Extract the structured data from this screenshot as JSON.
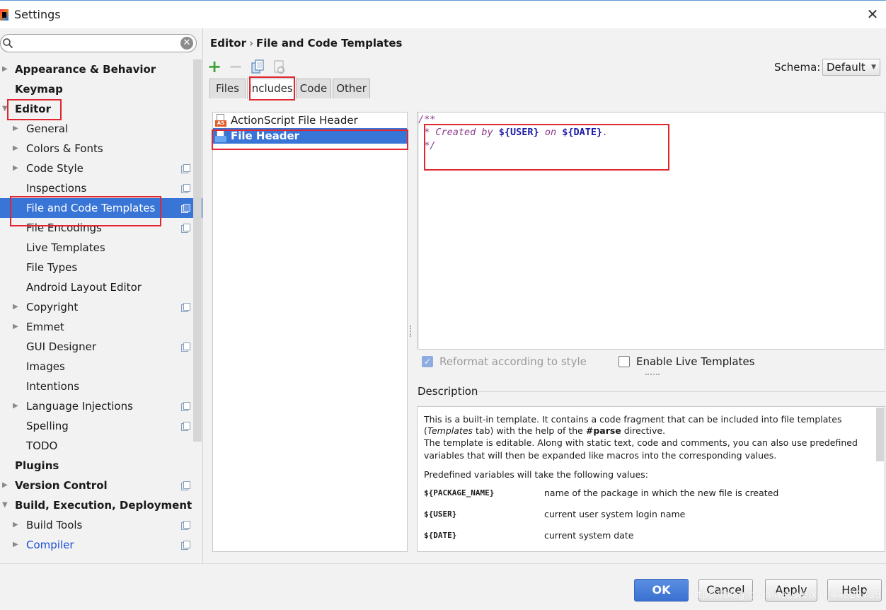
{
  "window": {
    "title": "Settings"
  },
  "search": {
    "value": "",
    "placeholder": ""
  },
  "sidebar": {
    "items": [
      {
        "label": "Appearance & Behavior",
        "level": 0,
        "arrow": "right"
      },
      {
        "label": "Keymap",
        "level": 0,
        "arrow": ""
      },
      {
        "label": "Editor",
        "level": 0,
        "arrow": "down"
      },
      {
        "label": "General",
        "level": 1,
        "arrow": "right"
      },
      {
        "label": "Colors & Fonts",
        "level": 1,
        "arrow": "right"
      },
      {
        "label": "Code Style",
        "level": 1,
        "arrow": "right",
        "project": true
      },
      {
        "label": "Inspections",
        "level": 1,
        "arrow": "",
        "project": true
      },
      {
        "label": "File and Code Templates",
        "level": 1,
        "arrow": "",
        "project": true,
        "selected": true
      },
      {
        "label": "File Encodings",
        "level": 1,
        "arrow": "",
        "project": true
      },
      {
        "label": "Live Templates",
        "level": 1,
        "arrow": ""
      },
      {
        "label": "File Types",
        "level": 1,
        "arrow": ""
      },
      {
        "label": "Android Layout Editor",
        "level": 1,
        "arrow": ""
      },
      {
        "label": "Copyright",
        "level": 1,
        "arrow": "right",
        "project": true
      },
      {
        "label": "Emmet",
        "level": 1,
        "arrow": "right"
      },
      {
        "label": "GUI Designer",
        "level": 1,
        "arrow": "",
        "project": true
      },
      {
        "label": "Images",
        "level": 1,
        "arrow": ""
      },
      {
        "label": "Intentions",
        "level": 1,
        "arrow": ""
      },
      {
        "label": "Language Injections",
        "level": 1,
        "arrow": "right",
        "project": true
      },
      {
        "label": "Spelling",
        "level": 1,
        "arrow": "",
        "project": true
      },
      {
        "label": "TODO",
        "level": 1,
        "arrow": ""
      },
      {
        "label": "Plugins",
        "level": 0,
        "arrow": ""
      },
      {
        "label": "Version Control",
        "level": 0,
        "arrow": "right",
        "project": true
      },
      {
        "label": "Build, Execution, Deployment",
        "level": 0,
        "arrow": "down"
      },
      {
        "label": "Build Tools",
        "level": 1,
        "arrow": "right",
        "project": true
      },
      {
        "label": "Compiler",
        "level": 1,
        "arrow": "right",
        "project": true,
        "link": true
      }
    ]
  },
  "breadcrumb": {
    "parent": "Editor",
    "separator": "›",
    "current": "File and Code Templates"
  },
  "schema": {
    "label": "Schema:",
    "value": "Default"
  },
  "tabs": [
    {
      "label": "Files",
      "active": false
    },
    {
      "label": "Includes",
      "active": true
    },
    {
      "label": "Code",
      "active": false
    },
    {
      "label": "Other",
      "active": false
    }
  ],
  "templates": [
    {
      "label": "ActionScript File Header",
      "badge": "AS",
      "selected": false
    },
    {
      "label": "File Header",
      "badge": "",
      "selected": true
    }
  ],
  "editor": {
    "line1": "/**",
    "line2_prefix": " * Created by ",
    "line2_var1": "${USER}",
    "line2_mid": " on ",
    "line2_var2": "${DATE}",
    "line2_suffix": ".",
    "line3": " */"
  },
  "options": {
    "reformat": {
      "label": "Reformat according to style",
      "checked": true,
      "enabled": false
    },
    "live_templates": {
      "label": "Enable Live Templates",
      "checked": false,
      "enabled": true
    }
  },
  "description": {
    "title": "Description",
    "p1a": "This is a built-in template. It contains a code fragment that can be included into file templates",
    "p1b_pre": "(",
    "p1b_em": "Templates",
    "p1b_mid": " tab) with the help of the ",
    "p1b_strong": "#parse",
    "p1b_post": " directive.",
    "p2a": "The template is editable. Along with static text, code and comments, you can also use predefined",
    "p2b": "variables that will then be expanded like macros into the corresponding values.",
    "p3": "Predefined variables will take the following values:",
    "vars": [
      {
        "name": "${PACKAGE_NAME}",
        "desc": "name of the package in which the new file is created"
      },
      {
        "name": "${USER}",
        "desc": "current user system login name"
      },
      {
        "name": "${DATE}",
        "desc": "current system date"
      }
    ]
  },
  "buttons": {
    "ok": "OK",
    "cancel": "Cancel",
    "apply": "Apply",
    "help": "Help"
  },
  "watermark": "https://blog.csdn.net/weixin_44520739",
  "colors": {
    "selection": "#3875d7",
    "annotation": "#e0262f",
    "comment": "#8a3b8a",
    "variable": "#1a1aa6"
  }
}
